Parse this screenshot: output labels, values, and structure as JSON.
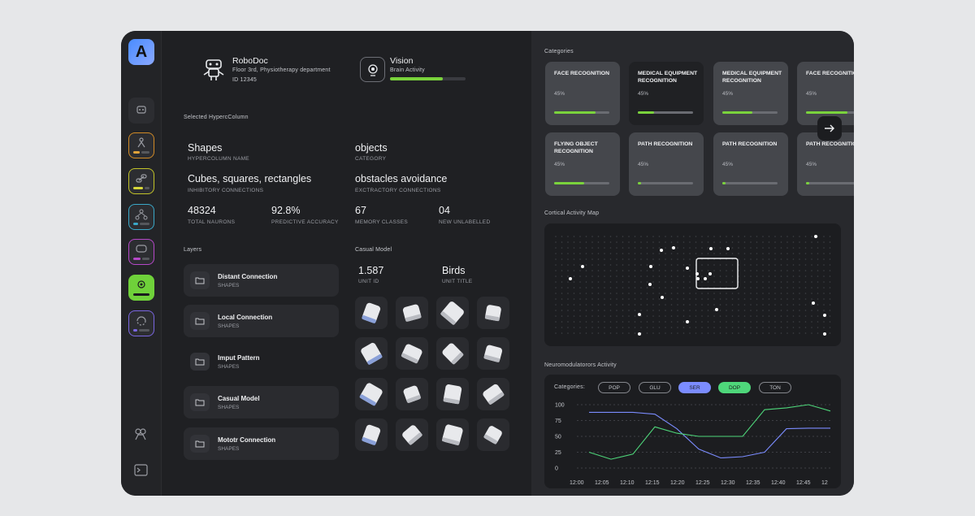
{
  "robot": {
    "name": "RoboDoc",
    "location": "Floor 3rd, Physiotherapy department",
    "id": "ID 12345"
  },
  "vision": {
    "title": "Vision",
    "subtitle": "Brain Activity",
    "progress": 0.7
  },
  "selected": {
    "heading": "Selected HypercColumn",
    "fields": [
      {
        "value": "Shapes",
        "label": "HYPERCOLUMN NAME"
      },
      {
        "value": "objects",
        "label": "CATEGORY"
      },
      {
        "value": "Cubes, squares, rectangles",
        "label": "INHIBITORY CONNECTIONS"
      },
      {
        "value": "obstacles avoidance",
        "label": "EXCTRACTORY CONNECTIONS"
      },
      {
        "value": "48324",
        "label": "TOTAL NAURONS"
      },
      {
        "value": "92.8%",
        "label": "PREDICTIVE ACCURACY"
      },
      {
        "value": "67",
        "label": "MEMORY CLASSES"
      },
      {
        "value": "04",
        "label": "NEW UNLABELLED"
      }
    ]
  },
  "layers": {
    "heading": "Layers",
    "items": [
      {
        "name": "Distant Connection",
        "sub": "SHAPES"
      },
      {
        "name": "Local Connection",
        "sub": "SHAPES"
      },
      {
        "name": "Imput Pattern",
        "sub": "SHAPES"
      },
      {
        "name": "Casual Model",
        "sub": "SHAPES"
      },
      {
        "name": "Mototr Connection",
        "sub": "SHAPES"
      }
    ]
  },
  "casual": {
    "heading": "Casual Model",
    "unit_id": "1.587",
    "unit_id_label": "UNIT ID",
    "unit_title": "Birds",
    "unit_title_label": "UNIT TITLE"
  },
  "categories": {
    "heading": "Categories",
    "cards": [
      {
        "title": "FACE RECOGNITION",
        "pct": "45%",
        "value": 0.75
      },
      {
        "title": "MEDICAL EQUIPMENT RECOGNITION",
        "pct": "45%",
        "value": 0.3
      },
      {
        "title": "MEDICAL EQUIPMENT RECOGNITION",
        "pct": "45%",
        "value": 0.55
      },
      {
        "title": "FACE RECOGNITION",
        "pct": "45%",
        "value": 0.75
      },
      {
        "title": "FLYING OBJECT RECOGNITION",
        "pct": "45%",
        "value": 0.55
      },
      {
        "title": "PATH RECOGNITION",
        "pct": "45%",
        "value": 0.05
      },
      {
        "title": "PATH RECOGNITION",
        "pct": "45%",
        "value": 0.05
      },
      {
        "title": "PATH RECOGNITION",
        "pct": "45%",
        "value": 0.05
      }
    ]
  },
  "cortical": {
    "heading": "Cortical Activity Map"
  },
  "neuro": {
    "heading": "Neuromodulatorors Activity",
    "categories_label": "Categories:",
    "pills": [
      {
        "label": "POP",
        "active": false,
        "color": ""
      },
      {
        "label": "GLU",
        "active": false,
        "color": ""
      },
      {
        "label": "SER",
        "active": true,
        "color": "#7b8cff"
      },
      {
        "label": "DOP",
        "active": true,
        "color": "#4ed67a"
      },
      {
        "label": "TON",
        "active": false,
        "color": ""
      }
    ]
  },
  "chart_data": {
    "type": "line",
    "x": [
      "12:00",
      "12:05",
      "12:10",
      "12:15",
      "12:20",
      "12:25",
      "12:30",
      "12:35",
      "12:40",
      "12:45",
      "12"
    ],
    "yticks": [
      0,
      25,
      50,
      75,
      100
    ],
    "ylim": [
      0,
      100
    ],
    "series": [
      {
        "name": "SER",
        "color": "#7b8cff",
        "values": [
          88,
          88,
          88,
          85,
          62,
          30,
          16,
          18,
          25,
          62,
          63,
          63
        ]
      },
      {
        "name": "DOP",
        "color": "#4ed67a",
        "values": [
          25,
          14,
          22,
          65,
          55,
          50,
          50,
          50,
          92,
          95,
          100,
          90
        ]
      }
    ]
  },
  "colors": {
    "accent": "#7ad33c",
    "brand": "#4a8cff"
  }
}
